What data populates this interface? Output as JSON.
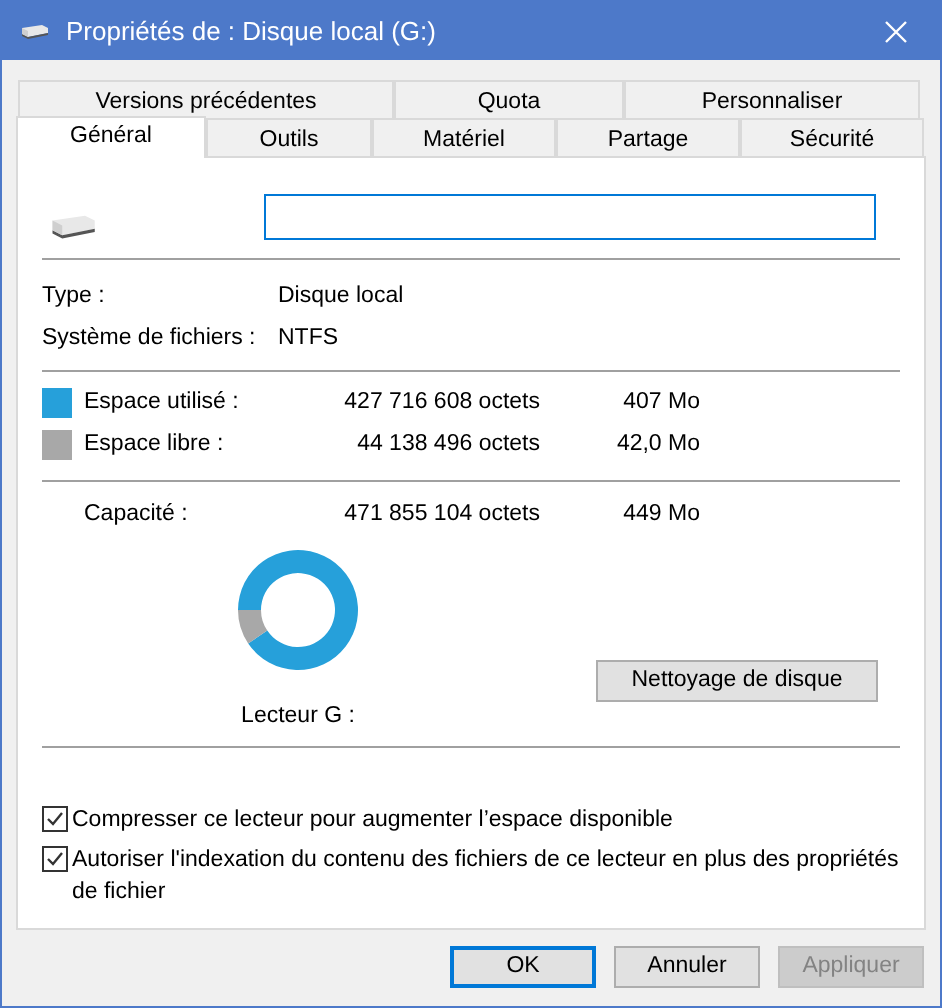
{
  "window": {
    "title": "Propriétés de : Disque local (G:)"
  },
  "tab_rows": [
    {
      "tabs": [
        {
          "label": "Versions précédentes",
          "selected": false
        },
        {
          "label": "Quota",
          "selected": false
        },
        {
          "label": "Personnaliser",
          "selected": false
        }
      ]
    },
    {
      "tabs": [
        {
          "label": "Général",
          "selected": true
        },
        {
          "label": "Outils",
          "selected": false
        },
        {
          "label": "Matériel",
          "selected": false
        },
        {
          "label": "Partage",
          "selected": false
        },
        {
          "label": "Sécurité",
          "selected": false
        }
      ]
    }
  ],
  "info": [
    {
      "label": "Type :",
      "value": "Disque local"
    },
    {
      "label": "Système de fichiers :",
      "value": "NTFS"
    }
  ],
  "space": [
    {
      "label": "Espace utilisé :",
      "bytes": "427 716 608 octets",
      "size": "407 Mo",
      "color": "#26a0da"
    },
    {
      "label": "Espace libre :",
      "bytes": "44 138 496 octets",
      "size": "42,0 Mo",
      "color": "#a8a8a8"
    }
  ],
  "capacity": {
    "label": "Capacité :",
    "bytes": "471 855 104 octets",
    "size": "449 Mo"
  },
  "chart_data": {
    "type": "donut",
    "values": [
      90.6,
      9.4
    ]
  },
  "drive_label": "Lecteur G :",
  "cleanup_button": "Nettoyage de disque",
  "options": [
    {
      "label": "Compresser ce lecteur pour augmenter l’espace disponible",
      "checked": true
    },
    {
      "label": "Autoriser l'indexation du contenu des fichiers de ce lecteur en plus des propriétés de fichier",
      "checked": true
    }
  ],
  "buttons": [
    {
      "label": "OK",
      "kind": "default",
      "disabled": false
    },
    {
      "label": "Annuler",
      "kind": "normal",
      "disabled": false
    },
    {
      "label": "Appliquer",
      "kind": "normal",
      "disabled": true
    }
  ]
}
